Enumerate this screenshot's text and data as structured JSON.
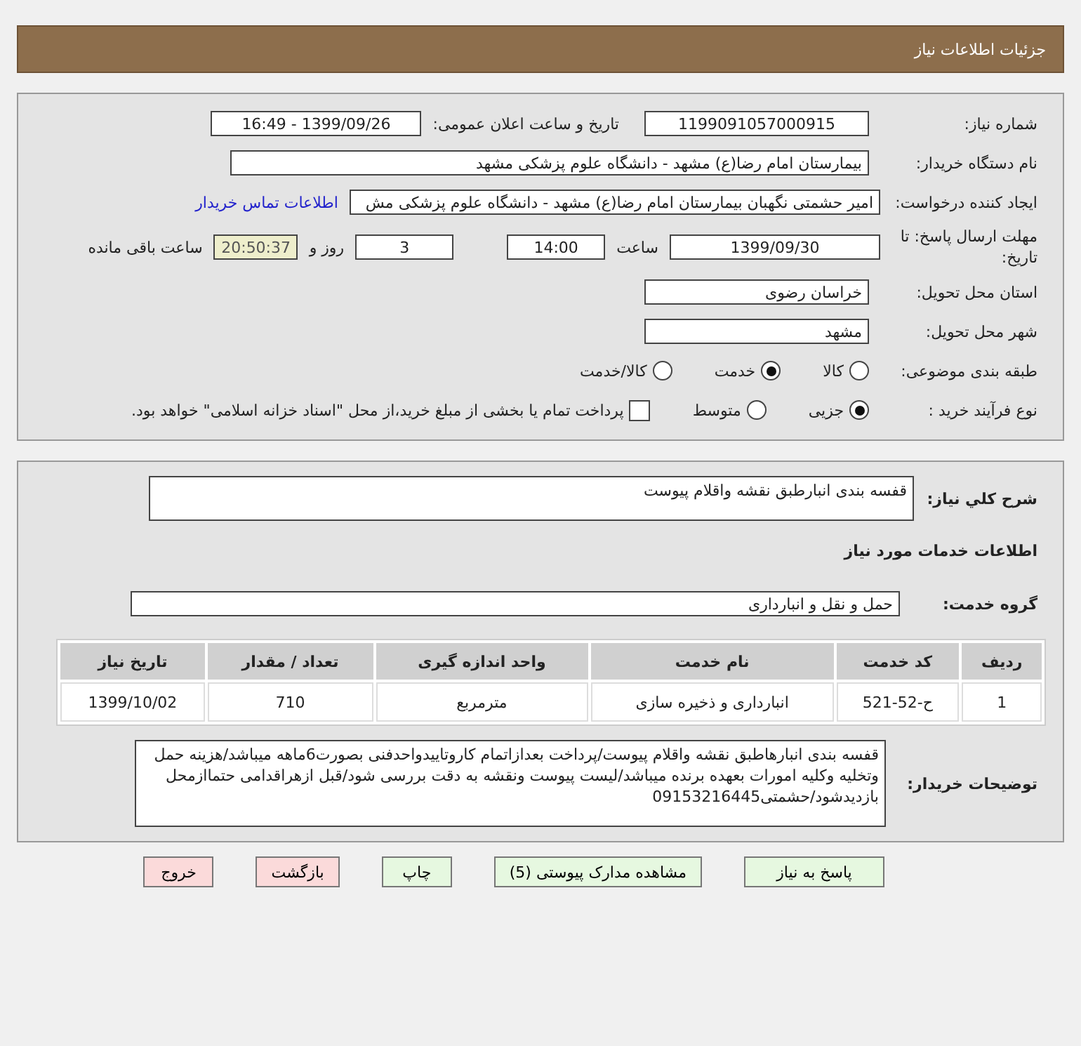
{
  "header": {
    "title": "جزئیات اطلاعات نیاز"
  },
  "need_number": {
    "label": "شماره نیاز:",
    "value": "1199091057000915"
  },
  "announce": {
    "label": "تاریخ و ساعت اعلان عمومی:",
    "value": "1399/09/26 - 16:49"
  },
  "buyer": {
    "label": "نام دستگاه خریدار:",
    "value": "بیمارستان امام رضا(ع) مشهد - دانشگاه علوم پزشکی مشهد"
  },
  "requester": {
    "label": "ایجاد کننده درخواست:",
    "value": "امیر حشمتی نگهبان بیمارستان امام رضا(ع) مشهد - دانشگاه علوم پزشکی مش",
    "link": "اطلاعات تماس خریدار"
  },
  "deadline": {
    "label": "مهلت ارسال پاسخ: تا تاریخ:",
    "date": "1399/09/30",
    "time_label": "ساعت",
    "time": "14:00",
    "days": "3",
    "days_label": "روز و",
    "remaining": "20:50:37",
    "remaining_label": "ساعت باقی مانده"
  },
  "province": {
    "label": "استان محل تحویل:",
    "value": "خراسان رضوی"
  },
  "city": {
    "label": "شهر محل تحویل:",
    "value": "مشهد"
  },
  "category": {
    "label": "طبقه بندی موضوعی:",
    "options": [
      {
        "label": "کالا",
        "selected": false
      },
      {
        "label": "خدمت",
        "selected": true
      },
      {
        "label": "کالا/خدمت",
        "selected": false
      }
    ]
  },
  "process": {
    "label": "نوع فرآیند خرید :",
    "options": [
      {
        "label": "جزیی",
        "selected": true
      },
      {
        "label": "متوسط",
        "selected": false
      }
    ],
    "payment": {
      "label": "پرداخت تمام یا بخشی از مبلغ خرید،از محل \"اسناد خزانه اسلامی\" خواهد بود.",
      "checked": false
    }
  },
  "description": {
    "label": "شرح کلي نياز:",
    "value": "قفسه بندی انبارطبق نقشه واقلام پیوست"
  },
  "services_title": "اطلاعات خدمات مورد نیاز",
  "service_group": {
    "label": "گروه خدمت:",
    "value": "حمل و نقل و انبارداری"
  },
  "table": {
    "columns": [
      "ردیف",
      "کد خدمت",
      "نام خدمت",
      "واحد اندازه گیری",
      "تعداد / مقدار",
      "تاریخ نیاز"
    ],
    "rows": [
      [
        "1",
        "ح-52-521",
        "انبارداری و ذخیره سازی",
        "مترمربع",
        "710",
        "1399/10/02"
      ]
    ]
  },
  "notes": {
    "label": "توضیحات خریدار:",
    "value": "قفسه بندی انبارهاطبق نقشه واقلام پیوست/پرداخت بعدازاتمام کاروتاییدواحدفنی بصورت6ماهه میباشد/هزینه حمل وتخلیه وکلیه امورات بعهده برنده میباشد/لیست پیوست ونقشه به دقت بررسی شود/قبل ازهراقدامی حتماازمحل بازدیدشود/حشمتی09153216445"
  },
  "buttons": [
    {
      "label": "پاسخ به نیاز",
      "kind": "primary"
    },
    {
      "label": "مشاهده مدارک پیوستی (5)",
      "kind": "primary"
    },
    {
      "label": "چاپ",
      "kind": "primary"
    },
    {
      "label": "بازگشت",
      "kind": "danger"
    },
    {
      "label": "خروج",
      "kind": "danger"
    }
  ]
}
